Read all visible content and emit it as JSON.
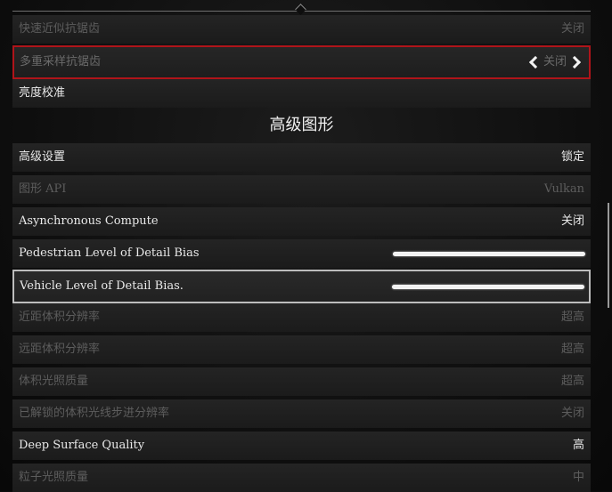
{
  "rows_top": [
    {
      "label": "快速近似抗锯齿",
      "value": "关闭",
      "state": "disabled"
    },
    {
      "label": "多重采样抗锯齿",
      "value": "关闭",
      "state": "selected"
    },
    {
      "label": "亮度校准",
      "value": "",
      "state": "normal"
    }
  ],
  "section": {
    "title": "高级图形"
  },
  "rows_advanced": [
    {
      "label": "高级设置",
      "value": "锁定",
      "state": "normal"
    },
    {
      "label": "图形 API",
      "value": "Vulkan",
      "state": "disabled"
    },
    {
      "label": "Asynchronous Compute",
      "value": "关闭",
      "state": "normal"
    },
    {
      "label": "Pedestrian Level of Detail Bias",
      "value": "",
      "state": "normal",
      "slider_level": 1.0
    },
    {
      "label": "Vehicle Level of Detail Bias.",
      "value": "",
      "state": "focused",
      "slider_level": 1.0
    },
    {
      "label": "近距体积分辨率",
      "value": "超高",
      "state": "disabled"
    },
    {
      "label": "远距体积分辨率",
      "value": "超高",
      "state": "disabled"
    },
    {
      "label": "体积光照质量",
      "value": "超高",
      "state": "disabled"
    },
    {
      "label": "已解锁的体积光线步进分辨率",
      "value": "关闭",
      "state": "disabled"
    },
    {
      "label": "Deep Surface Quality",
      "value": "高",
      "state": "normal"
    },
    {
      "label": "粒子光照质量",
      "value": "中",
      "state": "disabled"
    }
  ],
  "colors": {
    "selection_red": "#b0141a",
    "focus_white": "#bdbdbd",
    "text": "#e9e9e9",
    "text_disabled": "#5d5d5d"
  }
}
